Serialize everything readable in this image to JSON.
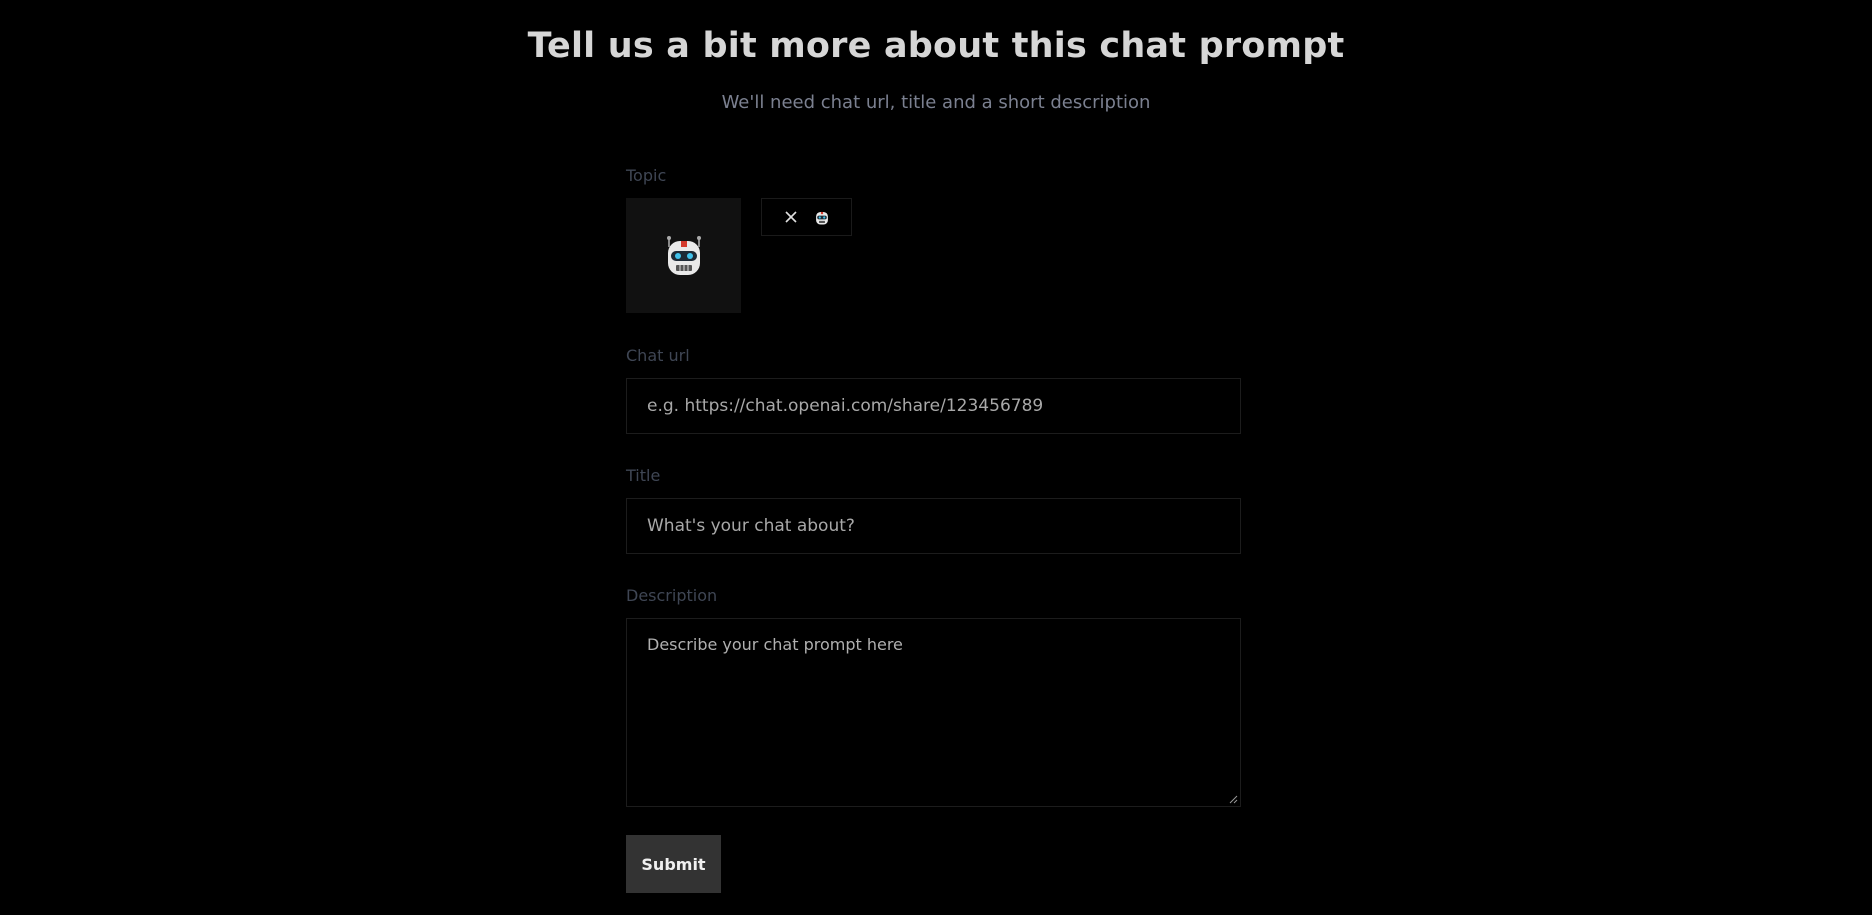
{
  "header": {
    "title": "Tell us a bit more about this chat prompt",
    "subtitle": "We'll need chat url, title and a short description"
  },
  "form": {
    "topic": {
      "label": "Topic",
      "selected_icon": "robot-icon",
      "chip_icon": "robot-icon"
    },
    "chat_url": {
      "label": "Chat url",
      "value": "",
      "placeholder": "e.g. https://chat.openai.com/share/123456789"
    },
    "title": {
      "label": "Title",
      "value": "",
      "placeholder": "What's your chat about?"
    },
    "description": {
      "label": "Description",
      "value": "",
      "placeholder": "Describe your chat prompt here"
    },
    "submit_label": "Submit"
  },
  "colors": {
    "background": "#000000",
    "heading": "#d6d6d6",
    "subtitle": "#7b8090",
    "label": "#3f4654",
    "tile": "#111111",
    "button": "#333333"
  }
}
